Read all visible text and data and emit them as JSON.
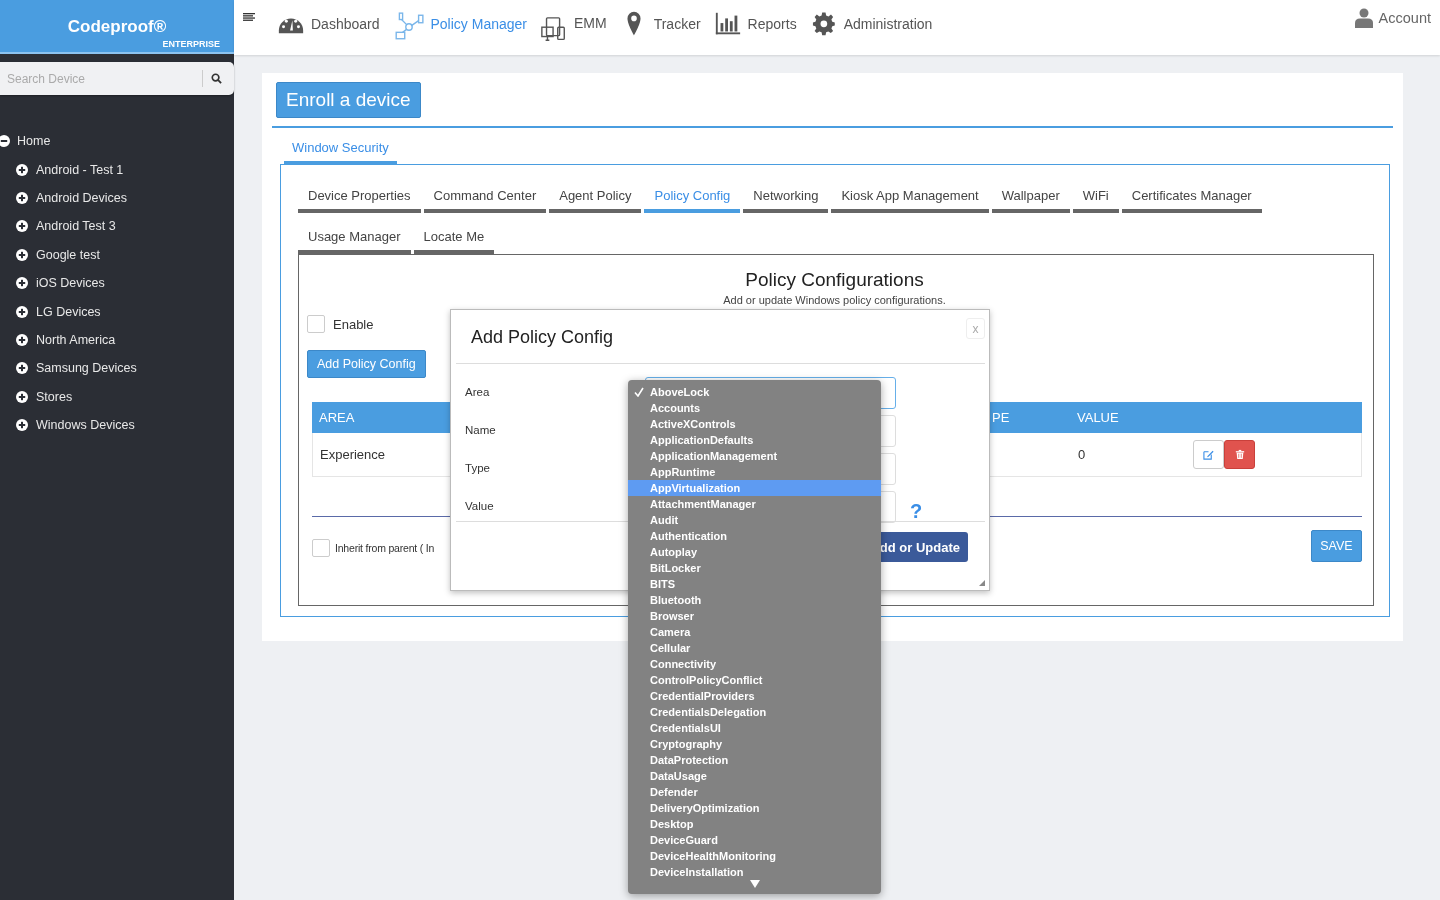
{
  "brand": {
    "name": "Codeproof®",
    "edition": "ENTERPRISE"
  },
  "search": {
    "placeholder": "Search Device"
  },
  "tree": {
    "label": "Home",
    "expanded": true,
    "children": [
      {
        "label": "Android - Test 1",
        "expanded": false
      },
      {
        "label": "Android Devices",
        "expanded": false
      },
      {
        "label": "Android Test 3",
        "expanded": false
      },
      {
        "label": "Google test",
        "expanded": false
      },
      {
        "label": "iOS Devices",
        "expanded": false
      },
      {
        "label": "LG Devices",
        "expanded": false
      },
      {
        "label": "North America",
        "expanded": false
      },
      {
        "label": "Samsung Devices",
        "expanded": false
      },
      {
        "label": "Stores",
        "expanded": false
      },
      {
        "label": "Windows Devices",
        "expanded": false
      }
    ]
  },
  "nav": [
    {
      "label": "Dashboard",
      "selected": false
    },
    {
      "label": "Policy Manager",
      "selected": true
    },
    {
      "label": "EMM",
      "selected": false
    },
    {
      "label": "Tracker",
      "selected": false
    },
    {
      "label": "Reports",
      "selected": false
    },
    {
      "label": "Administration",
      "selected": false
    }
  ],
  "account": "Account",
  "enroll_button": "Enroll a device",
  "section_tabs": [
    {
      "label": "Window Security",
      "selected": true
    }
  ],
  "tabs": [
    {
      "label": "Device Properties",
      "selected": false
    },
    {
      "label": "Command Center",
      "selected": false
    },
    {
      "label": "Agent Policy",
      "selected": false
    },
    {
      "label": "Policy Config",
      "selected": true
    },
    {
      "label": "Networking",
      "selected": false
    },
    {
      "label": "Kiosk App Management",
      "selected": false
    },
    {
      "label": "Wallpaper",
      "selected": false
    },
    {
      "label": "WiFi",
      "selected": false
    },
    {
      "label": "Certificates Manager",
      "selected": false
    },
    {
      "label": "Usage Manager",
      "selected": false
    },
    {
      "label": "Locate Me",
      "selected": false
    }
  ],
  "panel": {
    "title": "Policy Configurations",
    "subtitle": "Add or update Windows policy configurations.",
    "enable": {
      "label": "Enable",
      "checked": false
    },
    "add_button": "Add Policy Config",
    "table": {
      "columns": [
        "AREA",
        "PE",
        "VALUE"
      ],
      "rows": [
        {
          "area": "Experience",
          "value": "0"
        }
      ]
    },
    "inherit": {
      "label": "Inherit from parent ( In",
      "checked": false
    },
    "save_button": "SAVE"
  },
  "modal": {
    "title": "Add Policy Config",
    "close": "x",
    "fields": [
      "Area",
      "Name",
      "Type",
      "Value"
    ],
    "help": "?",
    "submit": "dd or Update"
  },
  "dropdown": {
    "options": [
      {
        "label": "AboveLock",
        "checked": true,
        "selected": false
      },
      {
        "label": "Accounts",
        "checked": false,
        "selected": false
      },
      {
        "label": "ActiveXControls",
        "checked": false,
        "selected": false
      },
      {
        "label": "ApplicationDefaults",
        "checked": false,
        "selected": false
      },
      {
        "label": "ApplicationManagement",
        "checked": false,
        "selected": false
      },
      {
        "label": "AppRuntime",
        "checked": false,
        "selected": false
      },
      {
        "label": "AppVirtualization",
        "checked": false,
        "selected": true
      },
      {
        "label": "AttachmentManager",
        "checked": false,
        "selected": false
      },
      {
        "label": "Audit",
        "checked": false,
        "selected": false
      },
      {
        "label": "Authentication",
        "checked": false,
        "selected": false
      },
      {
        "label": "Autoplay",
        "checked": false,
        "selected": false
      },
      {
        "label": "BitLocker",
        "checked": false,
        "selected": false
      },
      {
        "label": "BITS",
        "checked": false,
        "selected": false
      },
      {
        "label": "Bluetooth",
        "checked": false,
        "selected": false
      },
      {
        "label": "Browser",
        "checked": false,
        "selected": false
      },
      {
        "label": "Camera",
        "checked": false,
        "selected": false
      },
      {
        "label": "Cellular",
        "checked": false,
        "selected": false
      },
      {
        "label": "Connectivity",
        "checked": false,
        "selected": false
      },
      {
        "label": "ControlPolicyConflict",
        "checked": false,
        "selected": false
      },
      {
        "label": "CredentialProviders",
        "checked": false,
        "selected": false
      },
      {
        "label": "CredentialsDelegation",
        "checked": false,
        "selected": false
      },
      {
        "label": "CredentialsUI",
        "checked": false,
        "selected": false
      },
      {
        "label": "Cryptography",
        "checked": false,
        "selected": false
      },
      {
        "label": "DataProtection",
        "checked": false,
        "selected": false
      },
      {
        "label": "DataUsage",
        "checked": false,
        "selected": false
      },
      {
        "label": "Defender",
        "checked": false,
        "selected": false
      },
      {
        "label": "DeliveryOptimization",
        "checked": false,
        "selected": false
      },
      {
        "label": "Desktop",
        "checked": false,
        "selected": false
      },
      {
        "label": "DeviceGuard",
        "checked": false,
        "selected": false
      },
      {
        "label": "DeviceHealthMonitoring",
        "checked": false,
        "selected": false
      },
      {
        "label": "DeviceInstallation",
        "checked": false,
        "selected": false
      }
    ]
  }
}
